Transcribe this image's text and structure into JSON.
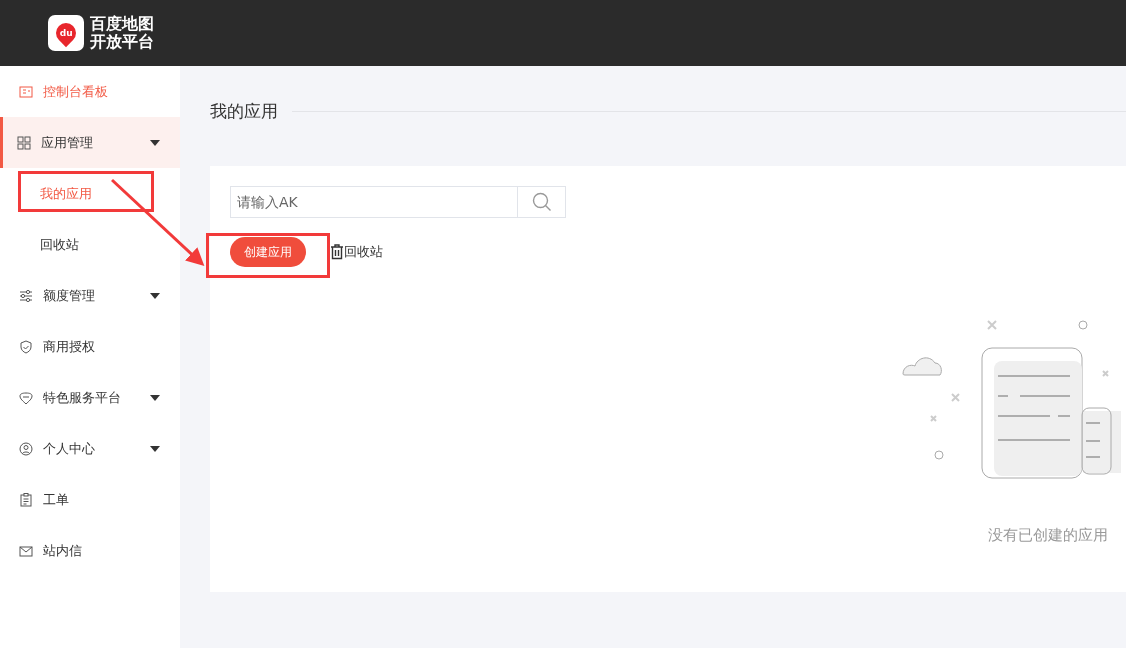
{
  "header": {
    "logo_line_1": "百度地图",
    "logo_line_2": "开放平台",
    "logo_badge": "du"
  },
  "sidebar": {
    "items": [
      {
        "label": "控制台看板",
        "selected": true,
        "active": false,
        "caret": false
      },
      {
        "label": "应用管理",
        "selected": false,
        "active": true,
        "caret": true,
        "children": [
          {
            "label": "我的应用",
            "selected": true
          },
          {
            "label": "回收站",
            "selected": false
          }
        ]
      },
      {
        "label": "额度管理",
        "selected": false,
        "active": false,
        "caret": true
      },
      {
        "label": "商用授权",
        "selected": false,
        "active": false,
        "caret": false
      },
      {
        "label": "特色服务平台",
        "selected": false,
        "active": false,
        "caret": true
      },
      {
        "label": "个人中心",
        "selected": false,
        "active": false,
        "caret": true
      },
      {
        "label": "工单",
        "selected": false,
        "active": false,
        "caret": false
      },
      {
        "label": "站内信",
        "selected": false,
        "active": false,
        "caret": false
      }
    ]
  },
  "main": {
    "title": "我的应用",
    "search": {
      "placeholder": "请输入AK"
    },
    "create_button": "创建应用",
    "recycle_link": "回收站",
    "empty_text": "没有已创建的应用"
  }
}
